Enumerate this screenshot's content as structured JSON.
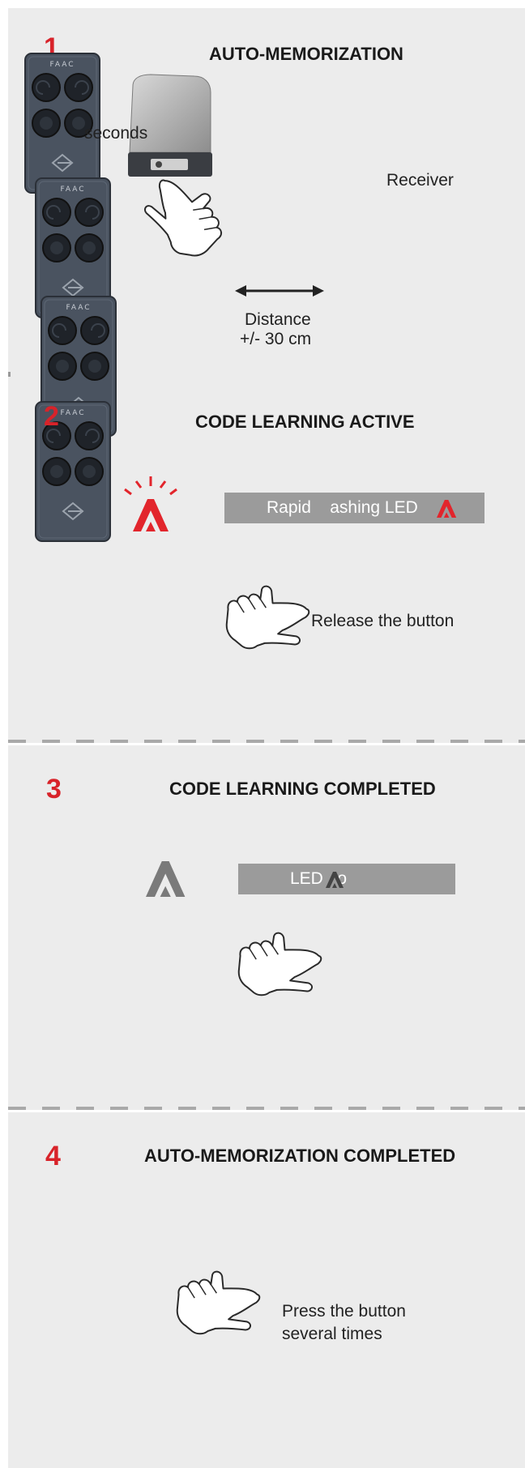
{
  "steps": [
    {
      "number": "1",
      "title": "AUTO-MEMORIZATION"
    },
    {
      "number": "2",
      "title": "CODE LEARNING ACTIVE"
    },
    {
      "number": "3",
      "title": "CODE LEARNING COMPLETED"
    },
    {
      "number": "4",
      "title": "AUTO-MEMORIZATION COMPLETED"
    }
  ],
  "labels": {
    "seconds": "seconds",
    "receiver": "Receiver",
    "distance_line1": "Distance",
    "distance_line2": "+/- 30 cm",
    "rapid_flashing": "Rapid    ashing LED",
    "release": "Release the button",
    "led_off": "LED   o",
    "press_line1": "Press the button",
    "press_line2": "several times"
  },
  "remote_brand": "FAAC",
  "colors": {
    "accent_red": "#d8232a",
    "panel_bg": "#ececec",
    "bar_grey": "#9b9b9b",
    "remote_body": "#4a5360"
  },
  "icons": [
    "remote-control-icon",
    "receiver-icon",
    "hand-pointer-icon",
    "led-indicator-icon",
    "double-arrow-icon"
  ]
}
